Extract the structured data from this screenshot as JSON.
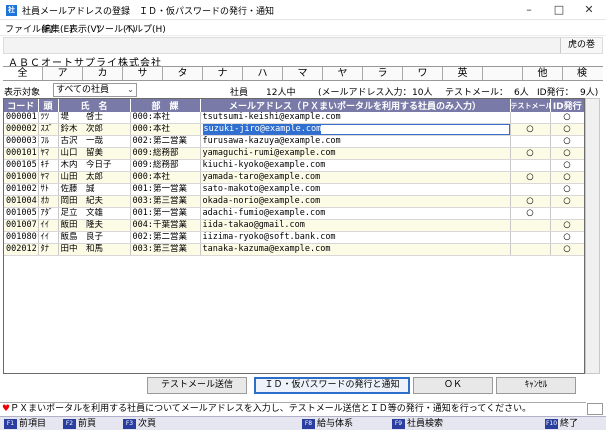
{
  "window": {
    "app_icon": "社",
    "title": "社員メールアドレスの登録　ＩＤ・仮パスワードの発行・通知",
    "controls": {
      "minimize": "–",
      "maximize": "□",
      "close": "✕"
    }
  },
  "menu": [
    "ファイル(F)",
    "編集(E)",
    "表示(V)",
    "ツール(T)",
    "ヘルプ(H)"
  ],
  "toolbar": {
    "tiger_button": "虎の巻"
  },
  "company_name": "ＡＢＣオートサプライ株式会社",
  "kana_tabs": [
    "全",
    "ア",
    "カ",
    "サ",
    "タ",
    "ナ",
    "ハ",
    "マ",
    "ヤ",
    "ラ",
    "ワ",
    "英",
    "",
    "他",
    "検"
  ],
  "filter": {
    "label": "表示対象",
    "value": "すべての社員",
    "chevron": "⌄"
  },
  "stats": {
    "employees": "社員　　12人中",
    "email_input": "(メールアドレス入力：",
    "email_count": "10人",
    "test_mail": "テストメール：",
    "test_count": "6人",
    "id_issue": "ID発行：",
    "id_count": "9人)"
  },
  "table": {
    "headers": [
      "コード",
      "頭",
      "氏　名",
      "部　課",
      "メールアドレス（ＰＸまいポータルを利用する社員のみ入力）",
      "テストメール",
      "ID発行"
    ],
    "rows": [
      {
        "code": "000001",
        "kana": "ﾂﾂ",
        "name": "堤　　啓士",
        "dept": "000:本社",
        "email": "tsutsumi-keishi@example.com",
        "test": "",
        "id": "○"
      },
      {
        "code": "000002",
        "kana": "ｽｽﾞ",
        "name": "鈴木　次郎",
        "dept": "000:本社",
        "email": "suzuki-jiro@example.com",
        "test": "○",
        "id": "○"
      },
      {
        "code": "000003",
        "kana": "ﾌﾙ",
        "name": "古沢　一哉",
        "dept": "002:第二営業",
        "email": "furusawa-kazuya@example.com",
        "test": "",
        "id": "○"
      },
      {
        "code": "000101",
        "kana": "ﾔﾏ",
        "name": "山口　留美",
        "dept": "009:総務部",
        "email": "yamaguchi-rumi@example.com",
        "test": "○",
        "id": "○"
      },
      {
        "code": "000105",
        "kana": "ｷﾁ",
        "name": "木内　今日子",
        "dept": "009:総務部",
        "email": "kiuchi-kyoko@example.com",
        "test": "",
        "id": "○"
      },
      {
        "code": "001000",
        "kana": "ﾔﾏ",
        "name": "山田　太郎",
        "dept": "000:本社",
        "email": "yamada-taro@example.com",
        "test": "○",
        "id": "○"
      },
      {
        "code": "001002",
        "kana": "ｻﾄ",
        "name": "佐藤　誠",
        "dept": "001:第一営業",
        "email": "sato-makoto@example.com",
        "test": "",
        "id": "○"
      },
      {
        "code": "001004",
        "kana": "ｵｶ",
        "name": "岡田　紀夫",
        "dept": "003:第三営業",
        "email": "okada-norio@example.com",
        "test": "○",
        "id": "○"
      },
      {
        "code": "001005",
        "kana": "ｱﾀﾞ",
        "name": "足立　文雄",
        "dept": "001:第一営業",
        "email": "adachi-fumio@example.com",
        "test": "○",
        "id": ""
      },
      {
        "code": "001007",
        "kana": "ｲｲ",
        "name": "飯田　隆夫",
        "dept": "004:千葉営業",
        "email": "iida-takao@gmail.com",
        "test": "",
        "id": "○"
      },
      {
        "code": "001080",
        "kana": "ｲｲ",
        "name": "飯島　良子",
        "dept": "002:第二営業",
        "email": "iizima-ryoko@soft.bank.com",
        "test": "",
        "id": "○"
      },
      {
        "code": "002012",
        "kana": "ﾀﾅ",
        "name": "田中　和馬",
        "dept": "003:第三営業",
        "email": "tanaka-kazuma@example.com",
        "test": "",
        "id": "○"
      }
    ]
  },
  "buttons": {
    "test_mail": "テストメール送信",
    "issue_notify": "ＩＤ・仮パスワードの発行と通知",
    "ok": "ＯＫ",
    "cancel": "ｷｬﾝｾﾙ"
  },
  "message": {
    "icon": "♥",
    "text": "ＰＸまいポータルを利用する社員についてメールアドレスを入力し、テストメール送信とＩＤ等の発行・通知を行ってください。"
  },
  "fkeys": [
    {
      "key": "F1",
      "label": "前項目"
    },
    {
      "key": "F2",
      "label": "前頁"
    },
    {
      "key": "F3",
      "label": "次頁"
    },
    {
      "key": "F8",
      "label": "給与体系"
    },
    {
      "key": "F9",
      "label": "社員検索"
    },
    {
      "key": "F10",
      "label": "終了"
    }
  ],
  "colors": {
    "header_bg": "#7a7aa8",
    "alt_row": "#fbfbe6",
    "selection": "#2f6fd0",
    "focus_border": "#2c6fc9"
  }
}
